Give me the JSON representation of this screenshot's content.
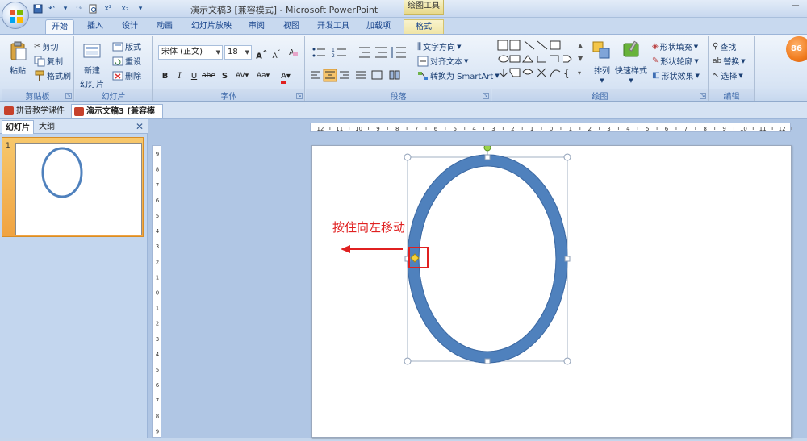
{
  "window": {
    "title": "演示文稿3 [兼容模式] - Microsoft PowerPoint",
    "context_title": "绘图工具",
    "minimize": "—"
  },
  "qat": [
    "save",
    "undo",
    "redo",
    "print-preview",
    "superscript",
    "subscript",
    "more"
  ],
  "qat_labels": {
    "superscript": "x²",
    "subscript": "x₂"
  },
  "tabs": [
    {
      "label": "开始",
      "active": true
    },
    {
      "label": "插入"
    },
    {
      "label": "设计"
    },
    {
      "label": "动画"
    },
    {
      "label": "幻灯片放映"
    },
    {
      "label": "审阅"
    },
    {
      "label": "视图"
    },
    {
      "label": "开发工具"
    },
    {
      "label": "加载项"
    },
    {
      "label": "格式",
      "context": true
    }
  ],
  "ribbon": {
    "clipboard": {
      "label": "剪贴板",
      "paste": "粘贴",
      "cut": "剪切",
      "copy": "复制",
      "format_painter": "格式刷"
    },
    "slides": {
      "label": "幻灯片",
      "new_slide_line1": "新建",
      "new_slide_line2": "幻灯片",
      "layout": "版式",
      "reset": "重设",
      "delete": "删除"
    },
    "font": {
      "label": "字体",
      "font_name": "宋体 (正文)",
      "font_size": "18",
      "bold": "B",
      "italic": "I",
      "underline": "U",
      "strike": "abe",
      "shadow": "S",
      "spacing": "AV",
      "case": "Aa",
      "grow": "A",
      "shrink": "A",
      "clear": "A"
    },
    "paragraph": {
      "label": "段落",
      "text_direction": "文字方向",
      "align_text": "对齐文本",
      "smartart": "转换为 SmartArt"
    },
    "drawing": {
      "label": "绘图",
      "arrange": "排列",
      "quick_styles": "快速样式",
      "shape_fill": "形状填充",
      "shape_outline": "形状轮廓",
      "shape_effects": "形状效果"
    },
    "editing": {
      "label": "编辑",
      "find": "查找",
      "replace": "替换",
      "select": "选择"
    }
  },
  "badge": "86",
  "doc_tabs": [
    {
      "label": "拼音教学课件"
    },
    {
      "label": "演示文稿3 [兼容模式]",
      "active": true
    }
  ],
  "left_pane": {
    "tabs": [
      "幻灯片",
      "大纲"
    ],
    "close": "✕",
    "slide_number": "1"
  },
  "ruler": {
    "h_ticks": [
      "12",
      "11",
      "10",
      "9",
      "8",
      "7",
      "6",
      "5",
      "4",
      "3",
      "2",
      "1",
      "0",
      "1",
      "2",
      "3",
      "4",
      "5",
      "6",
      "7",
      "8",
      "9",
      "10",
      "11",
      "12"
    ],
    "v_ticks": [
      "9",
      "8",
      "7",
      "6",
      "5",
      "4",
      "3",
      "2",
      "1",
      "0",
      "1",
      "2",
      "3",
      "4",
      "5",
      "6",
      "7",
      "8",
      "9"
    ]
  },
  "annotation": {
    "text": "按住向左移动",
    "color": "#e02020"
  },
  "colors": {
    "ellipse_fill": "#4f81bd",
    "ellipse_outline": "#3e6aa3",
    "accent": "#e02020"
  }
}
